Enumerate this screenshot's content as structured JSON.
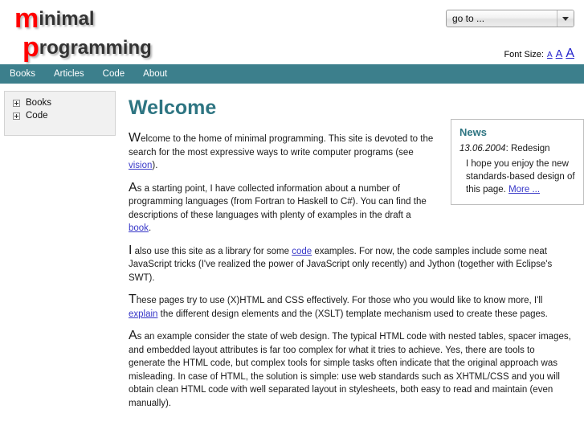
{
  "logo": {
    "line1_cap": "m",
    "line1_rest": "inimal",
    "line2_cap": "p",
    "line2_rest": "rogramming"
  },
  "header": {
    "goto_value": "go to ...",
    "goto_options": [
      "go to ..."
    ],
    "dropdown_icon": "chevron-down-icon",
    "fontsize_label": "Font Size:",
    "fontsize_small": "A",
    "fontsize_medium": "A",
    "fontsize_large": "A"
  },
  "nav": {
    "items": [
      {
        "label": "Books"
      },
      {
        "label": "Articles"
      },
      {
        "label": "Code"
      },
      {
        "label": "About"
      }
    ]
  },
  "sidebar": {
    "tree": [
      {
        "label": "Books",
        "toggle": "plus-icon"
      },
      {
        "label": "Code",
        "toggle": "plus-icon"
      }
    ]
  },
  "main": {
    "title": "Welcome",
    "paragraphs": [
      {
        "dropcap": "W",
        "parts": [
          {
            "type": "text",
            "value": "elcome to the home of minimal programming. This site is devoted to the search for the most expressive ways to write computer programs (see "
          },
          {
            "type": "link",
            "value": "vision"
          },
          {
            "type": "text",
            "value": ")."
          }
        ]
      },
      {
        "dropcap": "A",
        "parts": [
          {
            "type": "text",
            "value": "s a starting point, I have collected information about a number of programming languages (from Fortran to Haskell to C#). You can find the descriptions of these languages with plenty of examples in the draft a "
          },
          {
            "type": "link",
            "value": "book"
          },
          {
            "type": "text",
            "value": "."
          }
        ]
      },
      {
        "dropcap": "I",
        "parts": [
          {
            "type": "text",
            "value": " also use this site as a library for some "
          },
          {
            "type": "link",
            "value": "code"
          },
          {
            "type": "text",
            "value": " examples. For now, the code samples include some neat JavaScript tricks (I've realized the power of JavaScript only recently) and Jython (together with Eclipse's SWT)."
          }
        ]
      },
      {
        "dropcap": "T",
        "parts": [
          {
            "type": "text",
            "value": "hese pages try to use (X)HTML and CSS effectively. For those who you would like to know more, I'll "
          },
          {
            "type": "link",
            "value": "explain"
          },
          {
            "type": "text",
            "value": " the different design elements and the (XSLT) template mechanism used to create these pages."
          }
        ]
      },
      {
        "dropcap": "A",
        "parts": [
          {
            "type": "text",
            "value": "s an example consider the state of web design. The typical HTML code with nested tables, spacer images, and embedded layout attributes is far too complex for what it tries to achieve. Yes, there are tools to generate the HTML code, but complex tools for simple tasks often indicate that the original approach was misleading. In case of HTML, the solution is simple: use web standards such as XHTML/CSS and you will obtain clean HTML code with well separated layout in stylesheets, both easy to read and maintain (even manually)."
          }
        ]
      }
    ]
  },
  "news": {
    "heading": "News",
    "date": "13.06.2004",
    "date_suffix": ": Redesign",
    "body": "I hope you enjoy the new standards-based design of this page. ",
    "more_link": "More ..."
  },
  "colors": {
    "accent_teal": "#3c7f8c",
    "heading_teal": "#2e7582",
    "logo_red": "#ff0000",
    "link_blue": "#3838c8",
    "sidebar_bg": "#f1f1f1"
  }
}
